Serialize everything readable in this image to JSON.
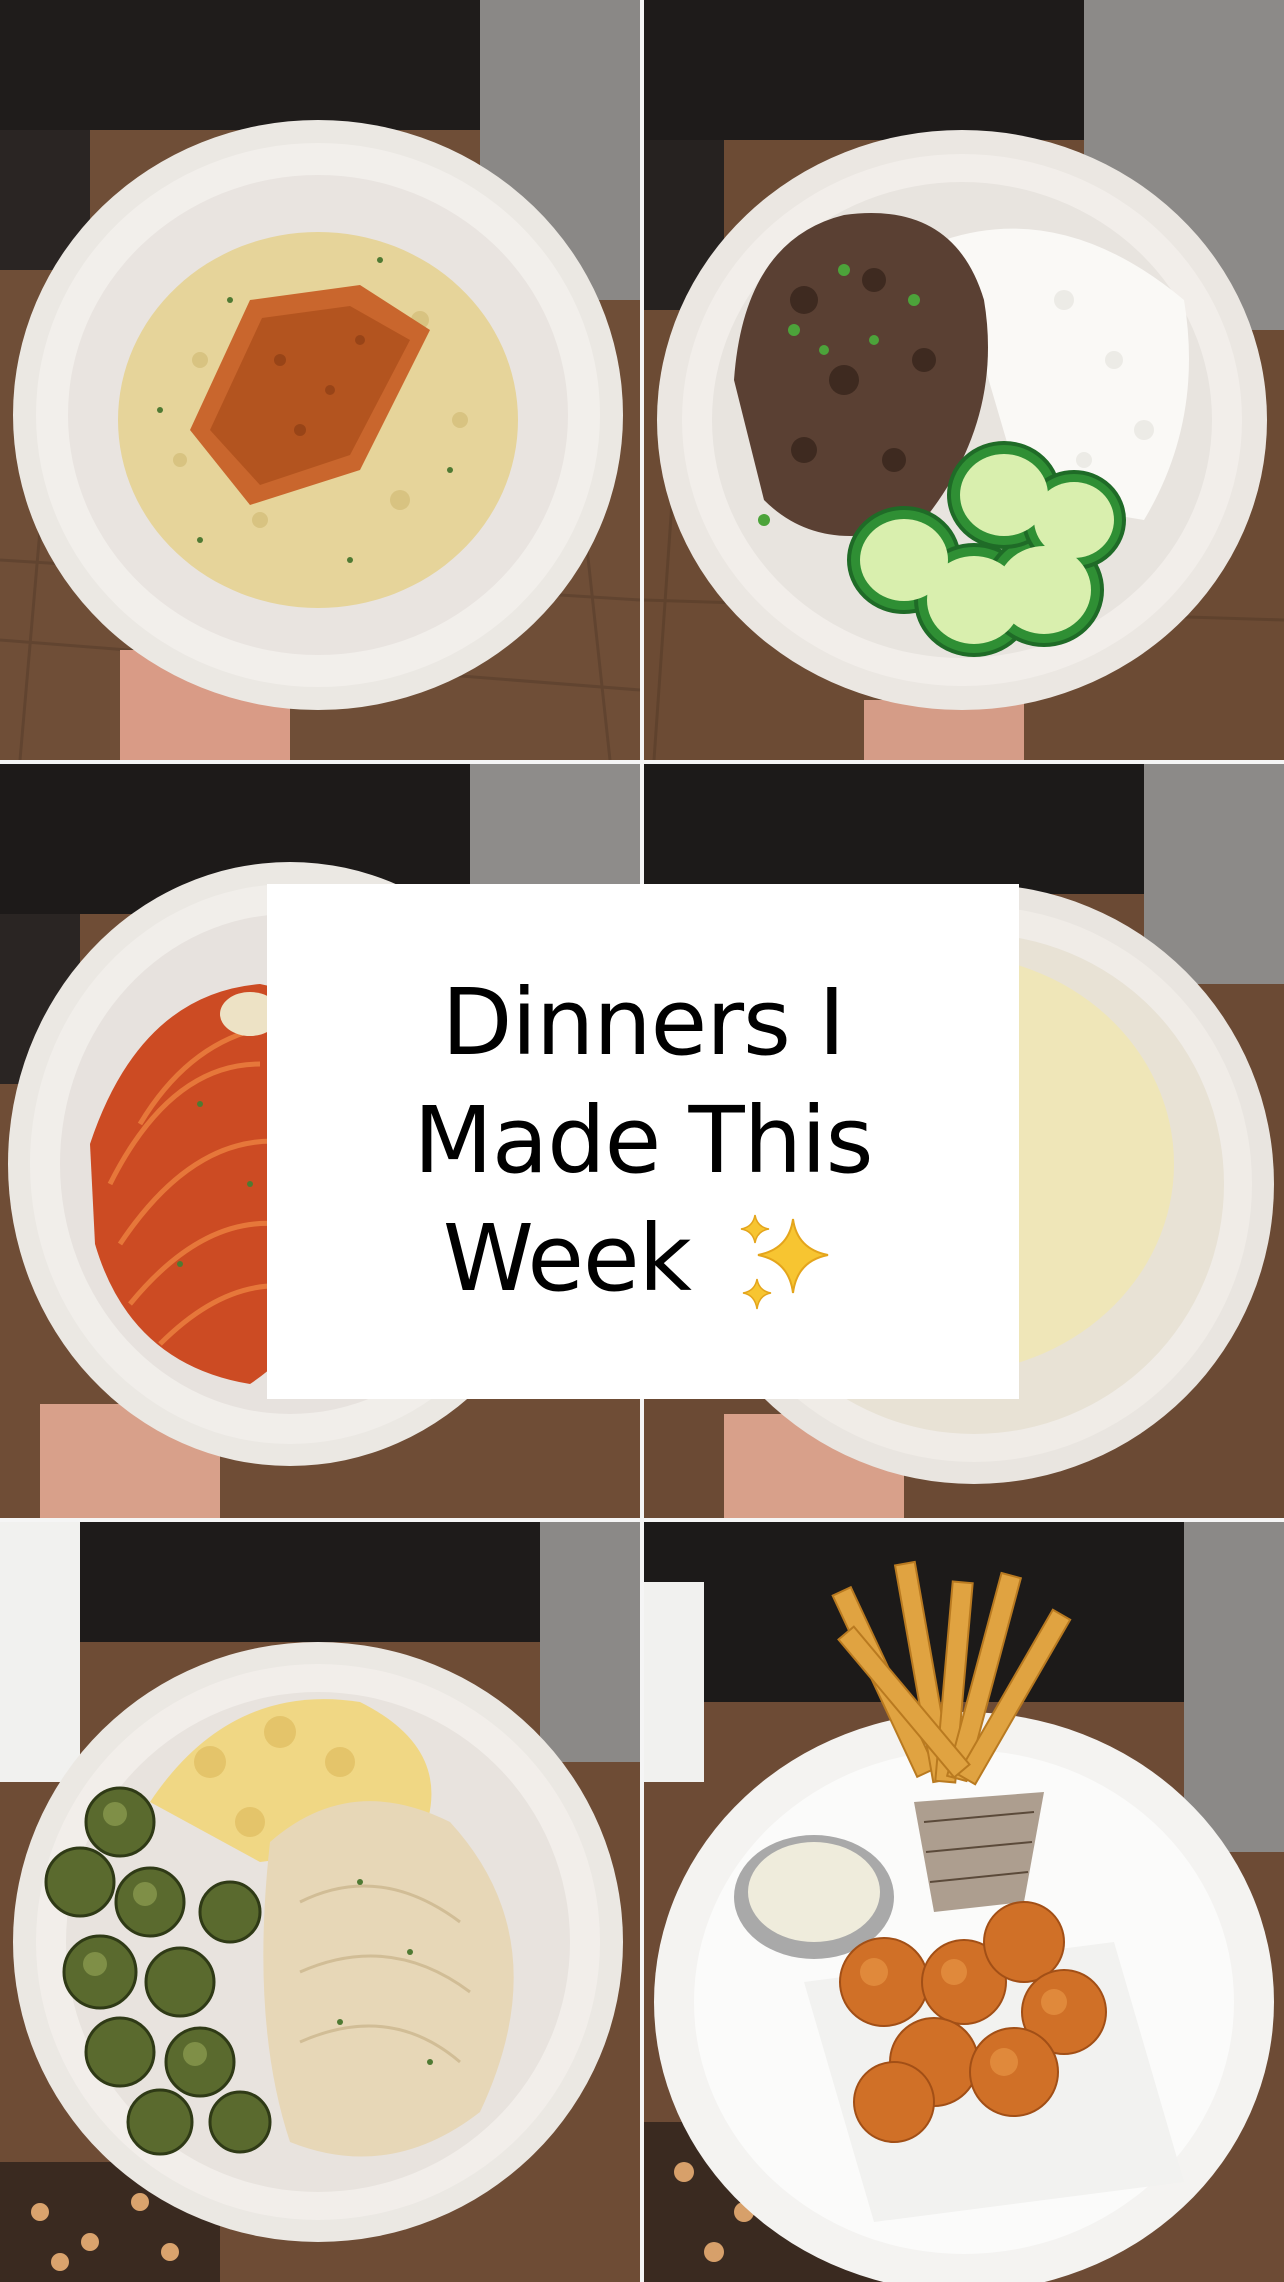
{
  "title_card": {
    "line1": "Dinners I",
    "line2": "Made This",
    "line3": "Week",
    "emoji": "sparkles-icon"
  },
  "photos": [
    {
      "name": "salmon-orzo"
    },
    {
      "name": "beef-rice-cucumber"
    },
    {
      "name": "spaghetti"
    },
    {
      "name": "chicken-corn-chowder"
    },
    {
      "name": "brussels-sprouts-noodles-chicken"
    },
    {
      "name": "fries-and-bites"
    }
  ],
  "colors": {
    "bowl": "#eeeae4",
    "floor": "#6b4a33",
    "cabinet": "#1e1b1a",
    "divider": "#f5f5f5"
  }
}
